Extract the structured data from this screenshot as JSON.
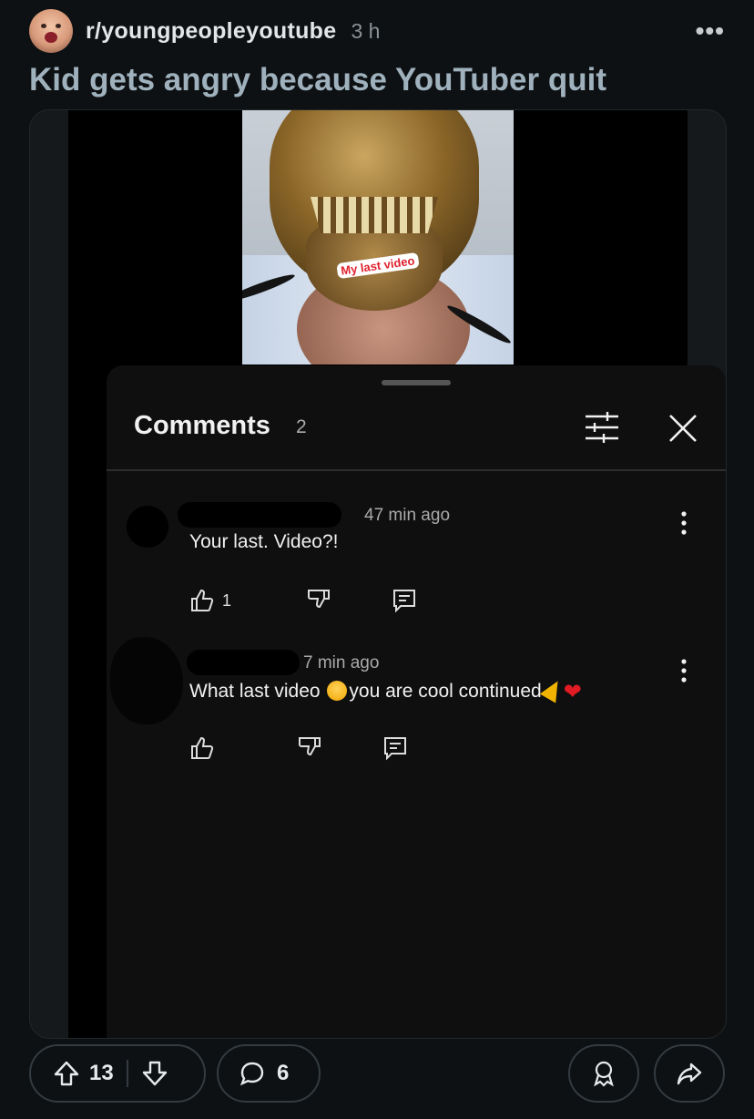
{
  "post": {
    "subreddit": "r/youngpeopleyoutube",
    "time": "3 h",
    "more": "•••",
    "title": "Kid gets angry because YouTuber quit"
  },
  "video": {
    "overlay_text": "My last video"
  },
  "comments_sheet": {
    "title": "Comments",
    "count": "2",
    "comments": [
      {
        "time": "47 min ago",
        "text": "Your last. Video?!",
        "likes": "1"
      },
      {
        "time": "7 min ago",
        "text_before": "What last video ",
        "text_after": "you are cool continued",
        "likes": ""
      }
    ]
  },
  "footer": {
    "upvotes": "13",
    "comments": "6"
  },
  "colors": {
    "background": "#0e1113",
    "title": "#9fb1bd",
    "overlay_text": "#e0222e",
    "heart": "#e01b24"
  }
}
